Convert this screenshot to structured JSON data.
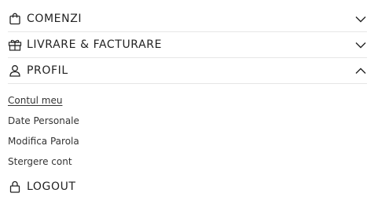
{
  "menu": {
    "sections": [
      {
        "label": "COMENZI",
        "icon": "shopping-bag-icon",
        "chevron": "chevron-down-icon",
        "expanded": false
      },
      {
        "label": "LIVRARE & FACTURARE",
        "icon": "gift-box-icon",
        "chevron": "chevron-down-icon",
        "expanded": false
      },
      {
        "label": "PROFIL",
        "icon": "user-icon",
        "chevron": "chevron-up-icon",
        "expanded": true
      }
    ],
    "profile_items": [
      {
        "label": "Contul meu",
        "active": true
      },
      {
        "label": "Date Personale",
        "active": false
      },
      {
        "label": "Modifica Parola",
        "active": false
      },
      {
        "label": "Stergere cont",
        "active": false
      }
    ],
    "logout": {
      "label": "LOGOUT",
      "icon": "lock-icon"
    }
  },
  "colors": {
    "text": "#222222",
    "divider": "#e6e6e6",
    "background": "#ffffff"
  }
}
